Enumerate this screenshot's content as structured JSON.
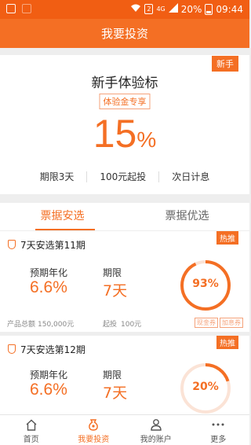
{
  "status_bar": {
    "battery": "20%",
    "time": "09:44",
    "network": "4G",
    "sim": "2"
  },
  "topbar": {
    "title": "我要投资"
  },
  "hero": {
    "badge": "新手",
    "title": "新手体验标",
    "tag": "体验金专享",
    "rate_value": "15",
    "rate_unit": "%",
    "terms": [
      "期限3天",
      "100元起投",
      "次日计息"
    ]
  },
  "tabs": [
    {
      "label": "票据安选",
      "active": true
    },
    {
      "label": "票据优选",
      "active": false
    }
  ],
  "cards": [
    {
      "hot": "热推",
      "name": "7天安选第11期",
      "rate_label": "预期年化",
      "rate": "6.6%",
      "term_label": "期限",
      "term": "7天",
      "total_label": "产品总额",
      "total": "150,000元",
      "min_label": "起投",
      "min": "100元",
      "chips": [
        "现金券",
        "加息券"
      ],
      "progress_label": "93%",
      "progress": 0.93
    },
    {
      "hot": "热推",
      "name": "7天安选第12期",
      "rate_label": "预期年化",
      "rate": "6.6%",
      "term_label": "期限",
      "term": "7天",
      "progress_label": "20%",
      "progress": 0.2
    }
  ],
  "bottom_nav": [
    {
      "label": "首页",
      "icon": "home-icon",
      "active": false
    },
    {
      "label": "我要投资",
      "icon": "money-bag-icon",
      "active": true
    },
    {
      "label": "我的账户",
      "icon": "user-icon",
      "active": false
    },
    {
      "label": "更多",
      "icon": "more-icon",
      "active": false
    }
  ],
  "colors": {
    "accent": "#f46f24",
    "status": "#f15e13",
    "ring_track": "#fbe3d6"
  }
}
